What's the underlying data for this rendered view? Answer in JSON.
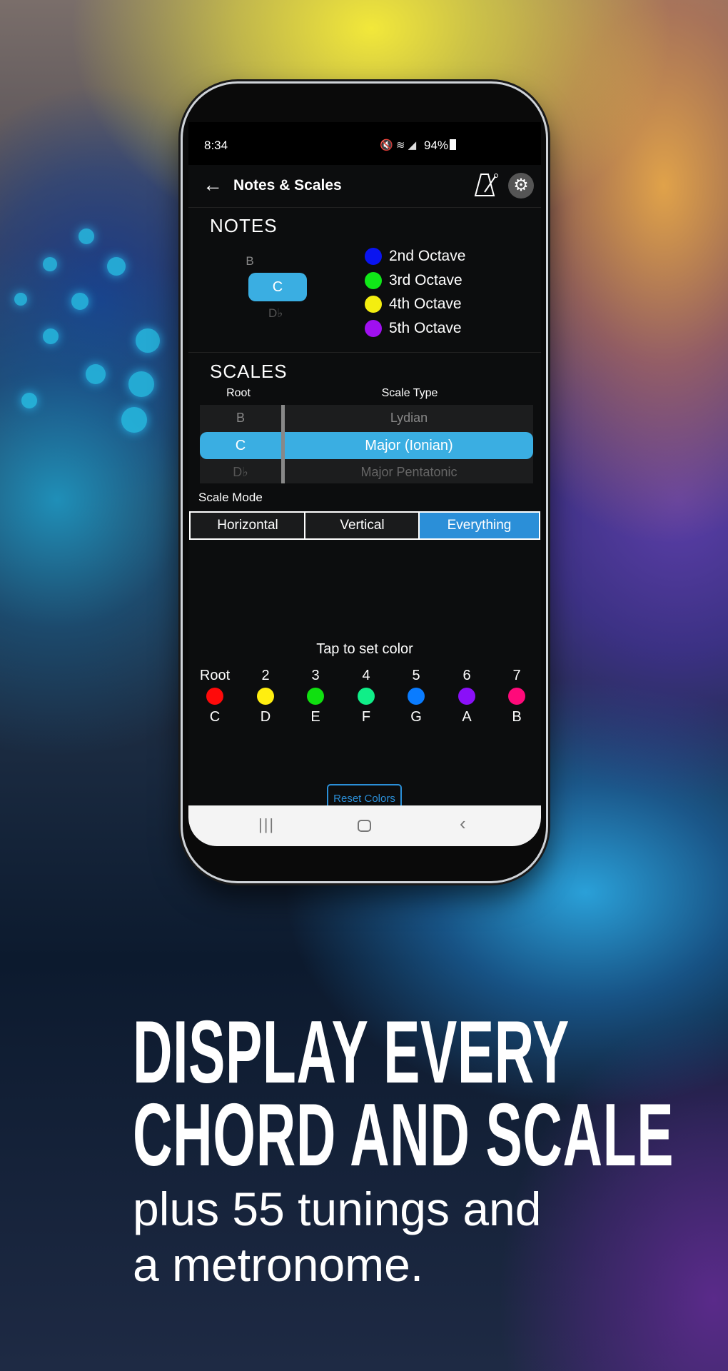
{
  "status_bar": {
    "time": "8:34",
    "battery": "94%"
  },
  "app_bar": {
    "title": "Notes & Scales",
    "back_icon": "arrow-left-icon",
    "metronome_icon": "metronome-icon",
    "settings_icon": "gear-icon"
  },
  "notes": {
    "title": "NOTES",
    "picker": {
      "prev": "B",
      "selected": "C",
      "next": "D♭"
    },
    "legend": [
      {
        "label": "2nd Octave",
        "color": "#0a14f0"
      },
      {
        "label": "3rd Octave",
        "color": "#10e818"
      },
      {
        "label": "4th Octave",
        "color": "#f4ee10"
      },
      {
        "label": "5th Octave",
        "color": "#a010f0"
      }
    ]
  },
  "scales": {
    "title": "SCALES",
    "root_header": "Root",
    "type_header": "Scale Type",
    "root": {
      "prev": "B",
      "selected": "C",
      "next": "D♭"
    },
    "type": {
      "prev": "Lydian",
      "selected": "Major (Ionian)",
      "next": "Major Pentatonic"
    },
    "mode_label": "Scale Mode",
    "modes": [
      {
        "label": "Horizontal",
        "selected": false
      },
      {
        "label": "Vertical",
        "selected": false
      },
      {
        "label": "Everything",
        "selected": true
      }
    ]
  },
  "colors": {
    "title": "Tap to set color",
    "degrees": [
      {
        "degree": "Root",
        "note": "C",
        "color": "#ff0a0a"
      },
      {
        "degree": "2",
        "note": "D",
        "color": "#ffee10"
      },
      {
        "degree": "3",
        "note": "E",
        "color": "#10e010"
      },
      {
        "degree": "4",
        "note": "F",
        "color": "#10ee88"
      },
      {
        "degree": "5",
        "note": "G",
        "color": "#0a7cff"
      },
      {
        "degree": "6",
        "note": "A",
        "color": "#8a10f8"
      },
      {
        "degree": "7",
        "note": "B",
        "color": "#ff0a7a"
      }
    ],
    "reset_label": "Reset Colors"
  },
  "accent": "#3aaee2",
  "headline": {
    "line1": "DISPLAY EVERY",
    "line2": "CHORD AND SCALE",
    "sub1": "plus 55 tunings and",
    "sub2": "a metronome."
  }
}
